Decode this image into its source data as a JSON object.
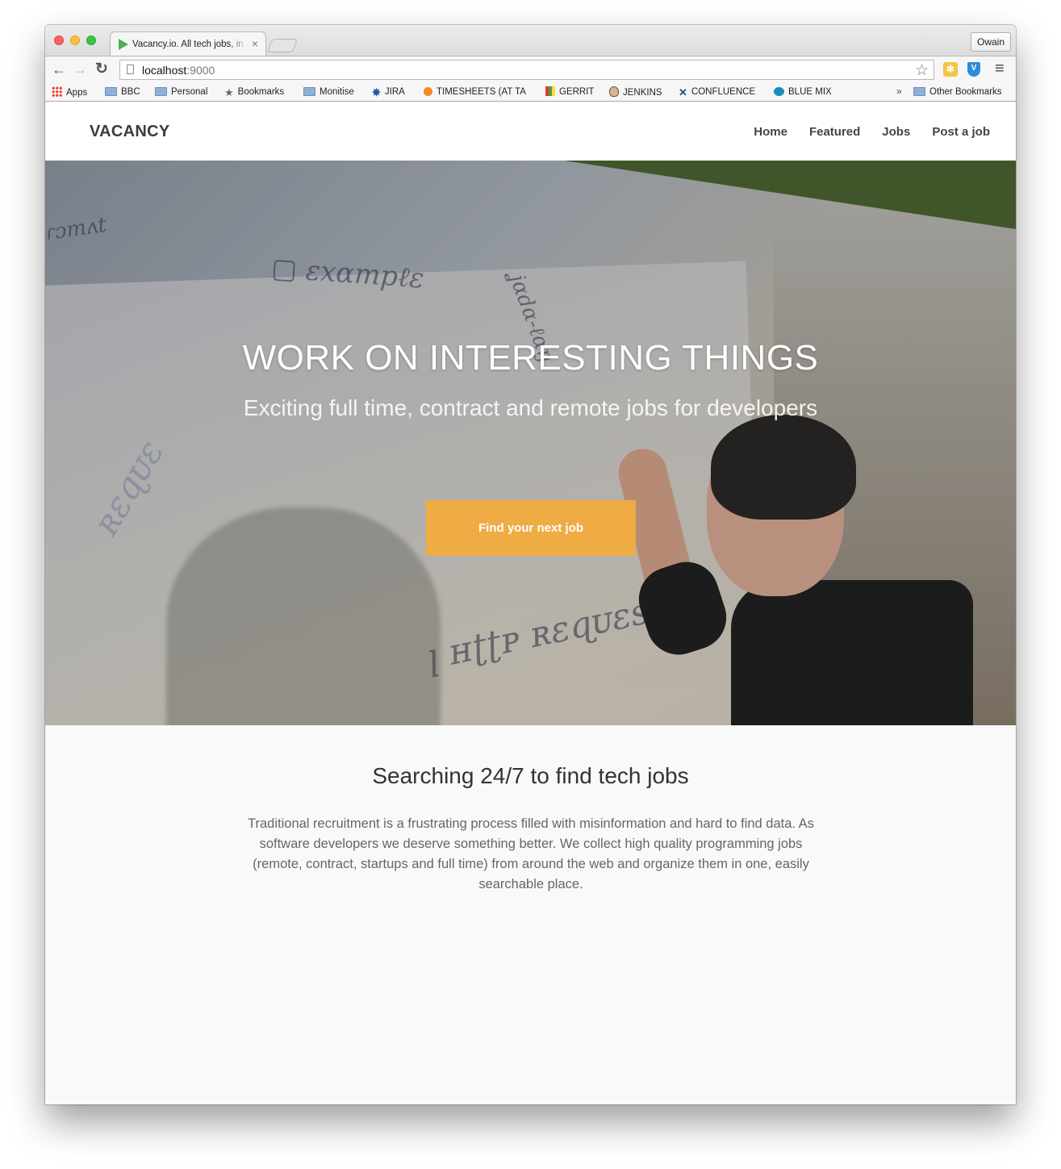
{
  "browser": {
    "tab_title": "Vacancy.io. All tech jobs, in one place",
    "tab_close": "×",
    "profile_label": "Owain",
    "url_host": "localhost",
    "url_port": ":9000",
    "star_glyph": "☆",
    "nav_back": "←",
    "nav_forward": "→",
    "nav_reload": "↻",
    "menu_glyph": "≡",
    "bookmarks": [
      {
        "label": "Apps",
        "icon": "apps-icon"
      },
      {
        "label": "BBC",
        "icon": "folder-icon"
      },
      {
        "label": "Personal",
        "icon": "folder-icon"
      },
      {
        "label": "Bookmarks",
        "icon": "star-icon"
      },
      {
        "label": "Monitise",
        "icon": "folder-icon"
      },
      {
        "label": "JIRA",
        "icon": "jira-icon"
      },
      {
        "label": "TIMESHEETS (AT TA",
        "icon": "timesheets-icon"
      },
      {
        "label": "GERRIT",
        "icon": "gerrit-icon"
      },
      {
        "label": "JENKINS",
        "icon": "jenkins-icon"
      },
      {
        "label": "CONFLUENCE",
        "icon": "confluence-icon"
      },
      {
        "label": "BLUE MIX",
        "icon": "bluemix-icon"
      }
    ],
    "bookmarks_overflow": "»",
    "other_bookmarks": "Other Bookmarks"
  },
  "site": {
    "brand": "VACANCY",
    "nav": [
      "Home",
      "Featured",
      "Jobs",
      "Post a job"
    ],
    "hero": {
      "title": "WORK ON INTERESTING THINGS",
      "subtitle": "Exciting full time, contract and remote jobs for developers",
      "cta": "Find your next job",
      "cta_color": "#efab44"
    },
    "about": {
      "title": "Searching 24/7 to find tech jobs",
      "text": "Traditional recruitment is a frustrating process filled with misinformation and hard to find data. As software developers we deserve something better. We collect high quality programming jobs (remote, contract, startups and full time) from around the web and organize them in one, easily searchable place."
    }
  }
}
